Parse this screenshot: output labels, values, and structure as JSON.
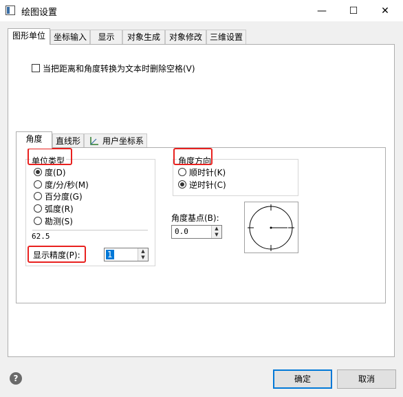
{
  "window": {
    "title": "绘图设置",
    "minimize": "—",
    "maximize": "☐",
    "close": "✕"
  },
  "tabs": [
    "图形单位",
    "坐标输入",
    "显示",
    "对象生成",
    "对象修改",
    "三维设置"
  ],
  "checkbox_label": "当把距离和角度转换为文本时删除空格(V)",
  "inner_tabs": [
    "角度",
    "直线形",
    "用户坐标系"
  ],
  "unit_type": {
    "legend": "单位类型",
    "options": [
      "度(D)",
      "度/分/秒(M)",
      "百分度(G)",
      "弧度(R)",
      "勘测(S)"
    ],
    "selected": 0,
    "sample": "62.5"
  },
  "precision": {
    "label": "显示精度(P):",
    "value": "1"
  },
  "direction": {
    "legend": "角度方向",
    "options": [
      "顺时针(K)",
      "逆时针(C)"
    ],
    "selected": 1
  },
  "base_angle": {
    "label": "角度基点(B):",
    "value": "0.0"
  },
  "buttons": {
    "ok": "确定",
    "cancel": "取消",
    "help": "?"
  }
}
